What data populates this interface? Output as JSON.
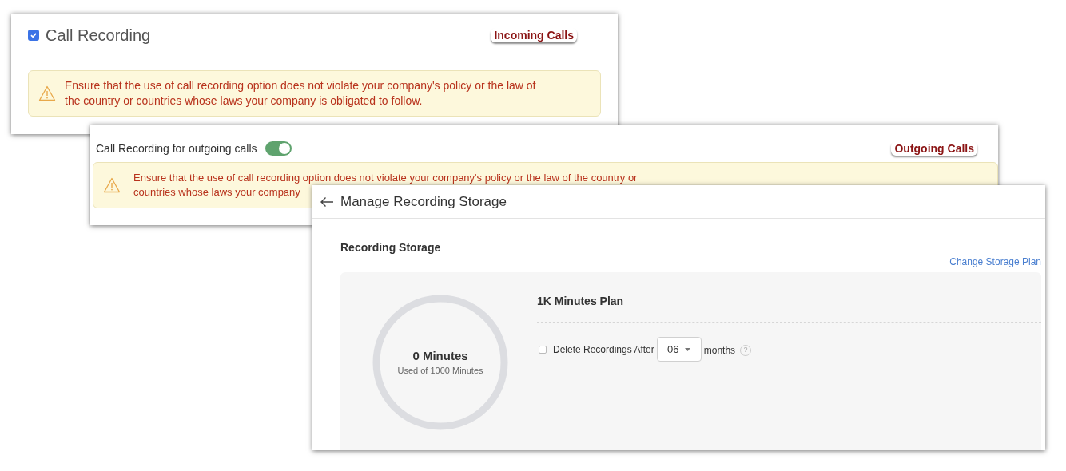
{
  "incoming": {
    "checkbox": {
      "label": "Call Recording",
      "checked": true
    },
    "annotation": "Incoming Calls",
    "warning": [
      "Ensure that the use of call recording option does not violate your company's policy or the law of",
      "the country or countries whose laws your company is obligated to follow."
    ]
  },
  "outgoing": {
    "toggle": {
      "label": "Call Recording for outgoing calls",
      "on": true
    },
    "annotation": "Outgoing Calls",
    "warning": [
      "Ensure that the use of call recording option does not violate your company's policy or the law of the country or",
      "countries whose laws your company"
    ]
  },
  "storage": {
    "title": "Manage Recording Storage",
    "section_title": "Recording Storage",
    "link": "Change Storage Plan",
    "usage": {
      "value": "0 Minutes",
      "caption": "Used of 1000 Minutes",
      "level": 0
    },
    "plan": "1K Minutes Plan",
    "delete_option": {
      "label": "Delete Recordings After",
      "checked": false,
      "months": "06",
      "unit": "months",
      "help": "?"
    }
  }
}
